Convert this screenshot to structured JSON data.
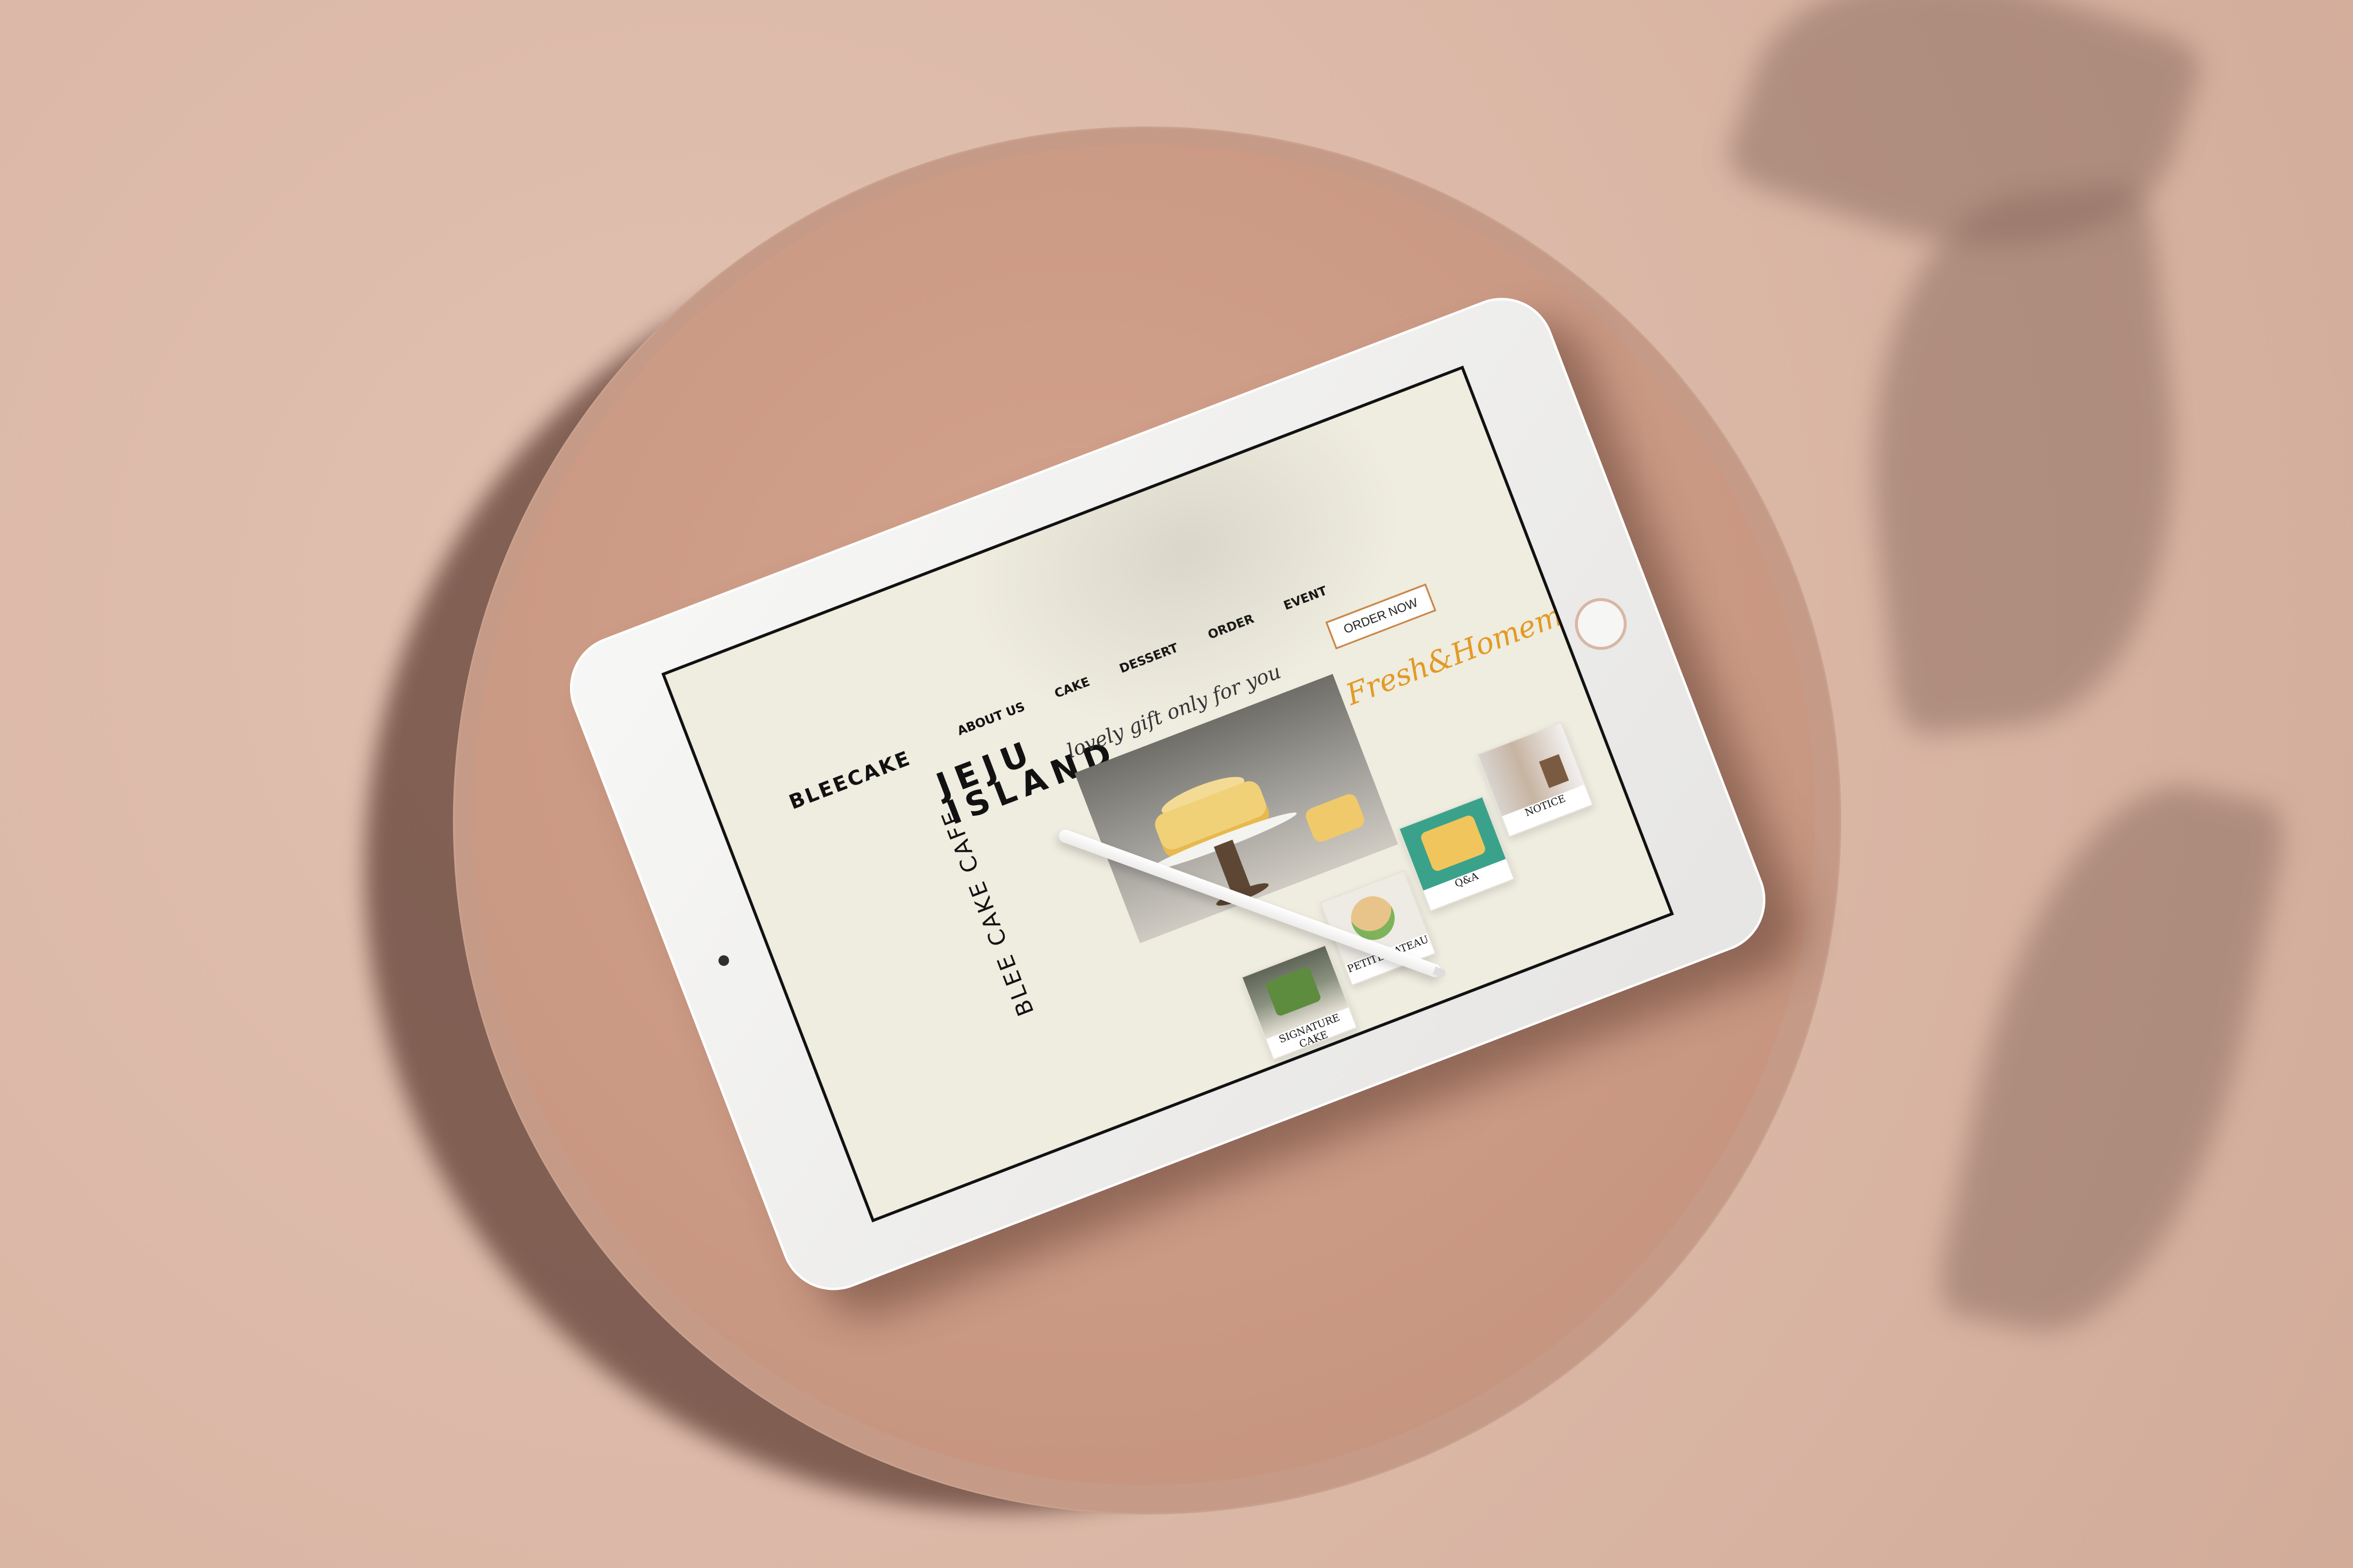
{
  "brand": {
    "name": "BLEECAKE"
  },
  "nav": {
    "items": [
      "ABOUT US",
      "CAKE",
      "DESSERT",
      "ORDER",
      "EVENT"
    ]
  },
  "hero": {
    "title_line1": "JEJU",
    "title_line2": "ISLAND",
    "tagline": "lovely gift only for you",
    "vertical_text": "BLEE CAKE CAFE",
    "cta": "ORDER NOW",
    "accent_text": "Fresh&Homemade"
  },
  "cards": [
    "SIGNATURE CAKE",
    "PETITE GATEAU",
    "Q&A",
    "NOTICE"
  ]
}
